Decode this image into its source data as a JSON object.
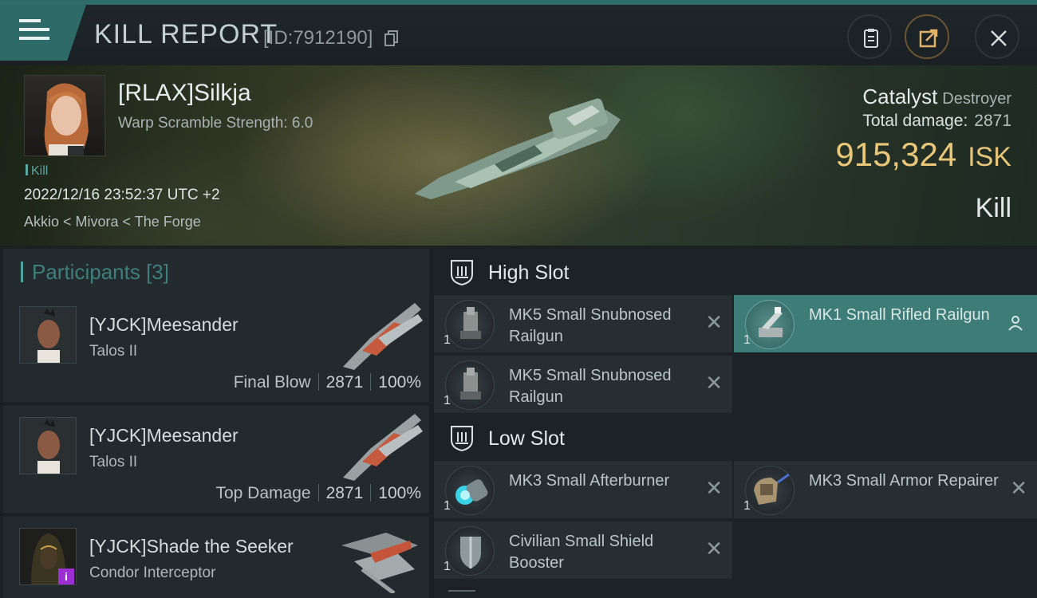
{
  "header": {
    "title": "KILL REPORT",
    "report_id": "[ID:7912190]"
  },
  "victim": {
    "name": "[RLAX]Silkja",
    "warp_scramble": "Warp Scramble Strength: 6.0",
    "tag": "Kill",
    "datetime": "2022/12/16 23:52:37 UTC +2",
    "location": "Akkio < Mivora < The Forge",
    "ship_name": "Catalyst",
    "ship_class": "Destroyer",
    "total_damage_label": "Total damage:",
    "total_damage": "2871",
    "isk_value": "915,324",
    "isk_unit": "ISK",
    "result": "Kill"
  },
  "participants": {
    "heading": "Participants [3]",
    "rows": [
      {
        "name": "[YJCK]Meesander",
        "ship": "Talos II",
        "label": "Final Blow",
        "damage": "2871",
        "percent": "100%"
      },
      {
        "name": "[YJCK]Meesander",
        "ship": "Talos II",
        "label": "Top Damage",
        "damage": "2871",
        "percent": "100%"
      },
      {
        "name": "[YJCK]Shade the Seeker",
        "ship": "Condor Interceptor",
        "badge": "i"
      }
    ]
  },
  "fitting": {
    "high_slot": {
      "label": "High Slot",
      "modules": [
        {
          "qty": "1",
          "name": "MK5 Small Snubnosed Railgun"
        },
        {
          "qty": "1",
          "name": "MK1 Small Rifled Railgun"
        },
        {
          "qty": "1",
          "name": "MK5 Small Snubnosed Railgun"
        }
      ]
    },
    "low_slot": {
      "label": "Low Slot",
      "modules": [
        {
          "qty": "1",
          "name": "MK3 Small Afterburner"
        },
        {
          "qty": "1",
          "name": "MK3 Small Armor Repairer"
        },
        {
          "qty": "1",
          "name": "Civilian Small Shield Booster"
        }
      ]
    },
    "remove_glyph": "✕"
  },
  "colors": {
    "accent_teal": "#2e6a68",
    "isk_gold": "#e9c77a",
    "highlight_row": "#3e7c78",
    "badge_purple": "#9b2fd1"
  },
  "icons": [
    "menu-icon",
    "copy-icon",
    "clipboard-icon",
    "export-icon",
    "close-icon",
    "slot-shield-icon",
    "person-icon",
    "remove-icon"
  ]
}
